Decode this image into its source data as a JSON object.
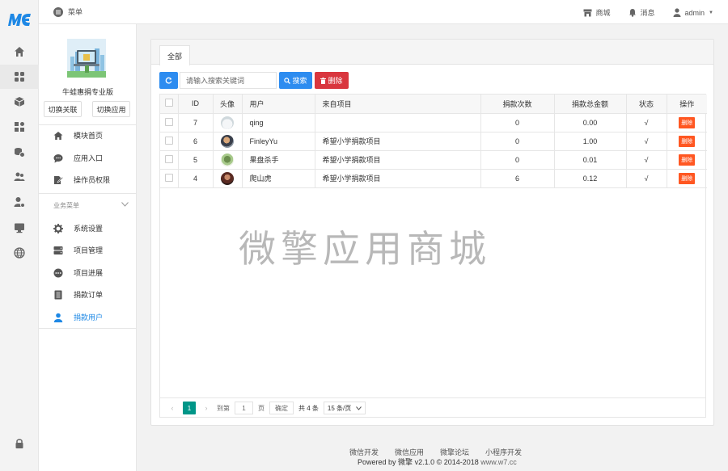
{
  "brand": {
    "logo_text": "ME",
    "accent": "#1e88e5"
  },
  "topbar": {
    "menu_label": "菜单",
    "store_label": "商城",
    "messages_label": "消息",
    "user_label": "admin"
  },
  "rail": {
    "items": [
      "home-icon",
      "apps-icon",
      "box-icon",
      "widgets-icon",
      "coins-icon",
      "users-icon",
      "user-settings-icon",
      "monitor-icon",
      "globe-icon",
      "lock-icon"
    ]
  },
  "sidebar": {
    "shop_name": "牛蛙惠捐专业版",
    "switch_link_label": "切换关联",
    "switch_app_label": "切换应用",
    "items": [
      {
        "label": "模块首页",
        "icon": "home-icon"
      },
      {
        "label": "应用入口",
        "icon": "chat-icon"
      },
      {
        "label": "操作员权限",
        "icon": "edit-icon"
      }
    ],
    "group_label": "业务菜单",
    "business_items": [
      {
        "label": "系统设置",
        "icon": "gear-icon"
      },
      {
        "label": "项目管理",
        "icon": "server-icon"
      },
      {
        "label": "项目进展",
        "icon": "dots-icon"
      },
      {
        "label": "捐款订单",
        "icon": "list-icon"
      },
      {
        "label": "捐款用户",
        "icon": "user-icon",
        "active": true
      }
    ]
  },
  "main": {
    "tab_label": "全部",
    "search_placeholder": "请输入搜索关键词",
    "search_label": "搜索",
    "delete_label": "删除",
    "columns": [
      "ID",
      "头像",
      "用户",
      "来自项目",
      "捐款次数",
      "捐款总金额",
      "状态",
      "操作"
    ],
    "rows": [
      {
        "id": "7",
        "user": "qing",
        "project": "",
        "count": "0",
        "amount": "0.00",
        "status": "√",
        "action": "删除"
      },
      {
        "id": "6",
        "user": "FinleyYu",
        "project": "希望小学捐款项目",
        "count": "0",
        "amount": "1.00",
        "status": "√",
        "action": "删除"
      },
      {
        "id": "5",
        "user": "果盘杀手",
        "project": "希望小学捐款项目",
        "count": "0",
        "amount": "0.01",
        "status": "√",
        "action": "删除"
      },
      {
        "id": "4",
        "user": "爬山虎",
        "project": "希望小学捐款项目",
        "count": "6",
        "amount": "0.12",
        "status": "√",
        "action": "删除"
      }
    ],
    "watermark": "微擎应用商城",
    "pager": {
      "current_page": "1",
      "goto_label": "到第",
      "goto_value": "1",
      "page_unit": "页",
      "confirm_label": "确定",
      "total_label": "共 4 条",
      "page_size": "15 条/页"
    }
  },
  "footer": {
    "links": [
      "微信开发",
      "微信应用",
      "微擎论坛",
      "小程序开发"
    ],
    "powered_prefix": "Powered by",
    "powered_name": "微擎",
    "version": "v2.1.0 © 2014-2018",
    "url": "www.w7.cc"
  }
}
